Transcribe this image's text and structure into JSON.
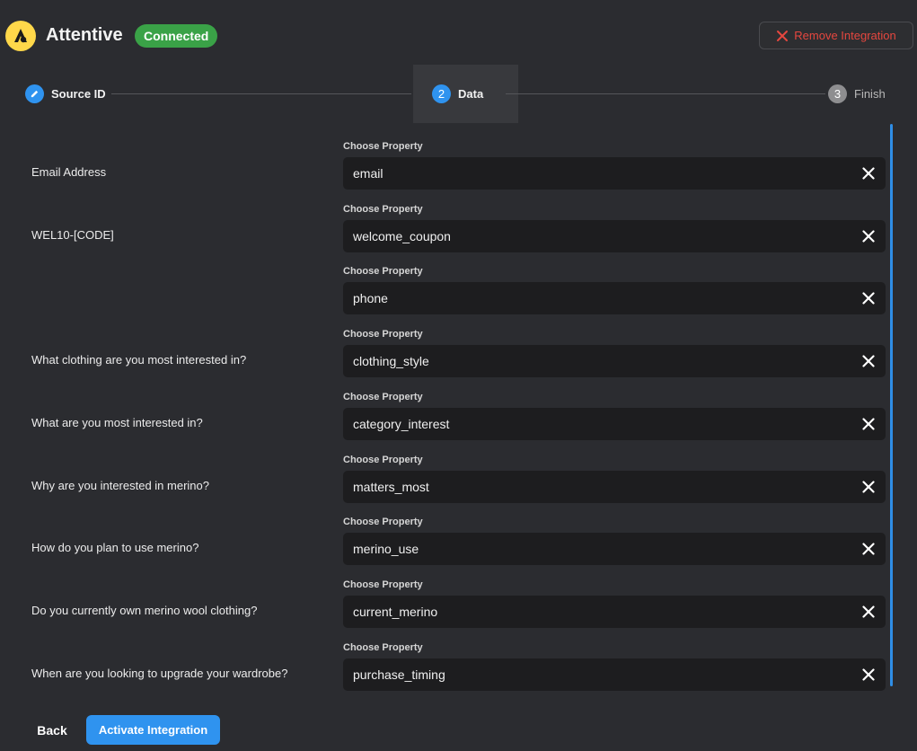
{
  "header": {
    "app_name": "Attentive",
    "status": "Connected",
    "remove_label": "Remove Integration"
  },
  "stepper": {
    "steps": [
      {
        "label": "Source ID",
        "state": "complete"
      },
      {
        "label": "Data",
        "number": "2",
        "state": "active"
      },
      {
        "label": "Finish",
        "number": "3",
        "state": "pending"
      }
    ]
  },
  "mapping": {
    "caption": "Choose Property",
    "rows": [
      {
        "label": "Email Address",
        "value": "email"
      },
      {
        "label": "WEL10-[CODE]",
        "value": "welcome_coupon"
      },
      {
        "label": "",
        "value": "phone"
      },
      {
        "label": "What clothing are you most interested in?",
        "value": "clothing_style"
      },
      {
        "label": "What are you most interested in?",
        "value": "category_interest"
      },
      {
        "label": "Why are you interested in merino?",
        "value": "matters_most"
      },
      {
        "label": "How do you plan to use merino?",
        "value": "merino_use"
      },
      {
        "label": "Do you currently own merino wool clothing?",
        "value": "current_merino"
      },
      {
        "label": "When are you looking to upgrade your wardrobe?",
        "value": "purchase_timing"
      }
    ]
  },
  "footer": {
    "back_label": "Back",
    "activate_label": "Activate Integration"
  },
  "colors": {
    "background": "#2b2c30",
    "accent": "#2f93ef",
    "connected": "#3aa247",
    "danger": "#e5473f",
    "logo": "#ffd84a"
  },
  "icons": {
    "logo": "attentive-logo-icon",
    "remove": "close-icon",
    "step_complete": "pencil-icon",
    "clear": "close-icon"
  }
}
